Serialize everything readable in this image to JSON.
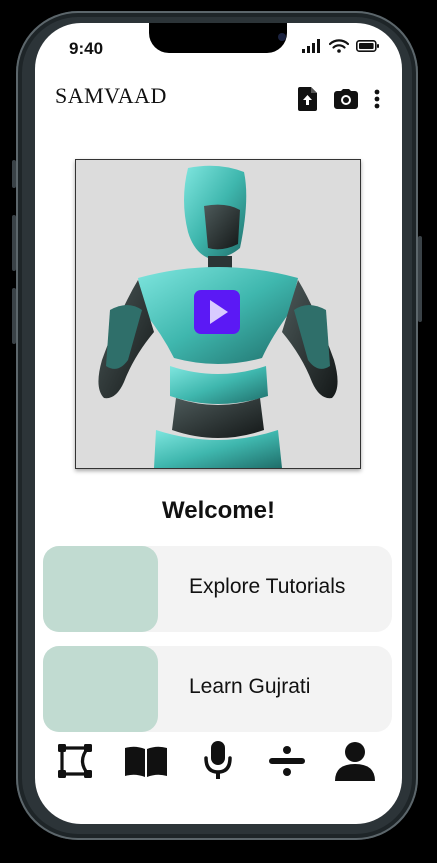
{
  "status": {
    "time": "9:40"
  },
  "app": {
    "title": "SAMVAAD"
  },
  "toolbar": {
    "icons": [
      "upload-file-icon",
      "camera-icon",
      "more-vert-icon"
    ]
  },
  "video": {
    "thumbnail": "3d-robot-avatar",
    "play_icon": "play-icon",
    "accent_color": "#5b19f5"
  },
  "main": {
    "welcome": "Welcome!"
  },
  "cards": [
    {
      "label": "Explore Tutorials"
    },
    {
      "label": "Learn Gujrati"
    }
  ],
  "bottom_nav": {
    "icons": [
      "vector-path-icon",
      "book-icon",
      "microphone-icon",
      "divide-icon",
      "person-icon"
    ]
  },
  "colors": {
    "card_thumb": "#c1dbd1",
    "card_bg": "#f3f3f3"
  }
}
